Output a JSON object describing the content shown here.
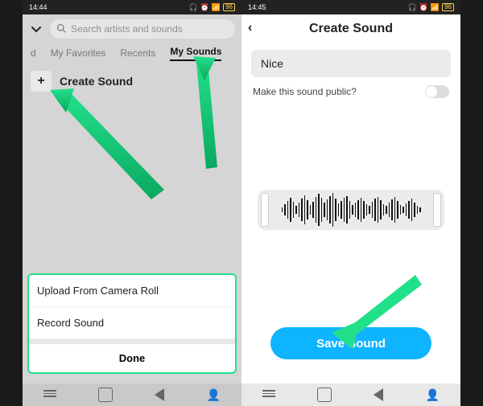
{
  "status": {
    "time_left": "14:44",
    "time_right": "14:45",
    "dot": "●",
    "battery": "96"
  },
  "left": {
    "search_placeholder": "Search artists and sounds",
    "tabs": {
      "featured_cut": "d",
      "favorites": "My Favorites",
      "recents": "Recents",
      "mysounds": "My Sounds"
    },
    "create_label": "Create Sound",
    "sheet": {
      "upload": "Upload From Camera Roll",
      "record": "Record Sound",
      "done": "Done"
    }
  },
  "right": {
    "title": "Create Sound",
    "sound_name": "Nice",
    "public_label": "Make this sound public?",
    "save_label": "Save Sound"
  }
}
